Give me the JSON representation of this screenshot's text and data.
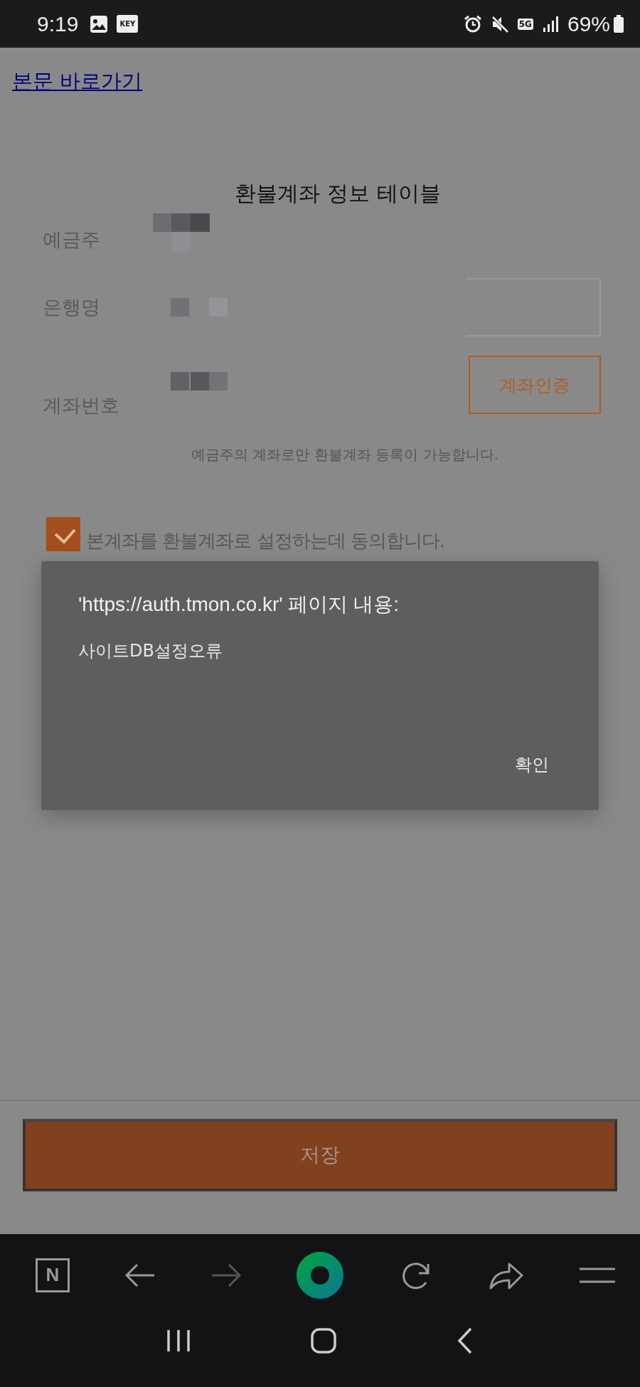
{
  "status_bar": {
    "time": "9:19",
    "key_badge": "KEY",
    "network": "5G",
    "battery": "69%"
  },
  "skip_link": "본문 바로가기",
  "form": {
    "title": "환불계좌 정보 테이블",
    "fields": [
      {
        "label": "예금주",
        "kind": "text"
      },
      {
        "label": "은행명",
        "kind": "select"
      },
      {
        "label": "계좌번호",
        "kind": "account"
      }
    ],
    "verify_button": "계좌인증",
    "note": "예금주의 계좌로만 환불계좌 등록이 가능합니다.",
    "agree": {
      "label": "본계좌를 환불계좌로 설정하는데 동의합니다.",
      "checked": true
    }
  },
  "dialog": {
    "title": "'https://auth.tmon.co.kr' 페이지 내용:",
    "message": "사이트DB설정오류",
    "buttons": [
      "확인"
    ]
  },
  "save_button": "저장",
  "browser_bar": {
    "home_logo": "N"
  }
}
